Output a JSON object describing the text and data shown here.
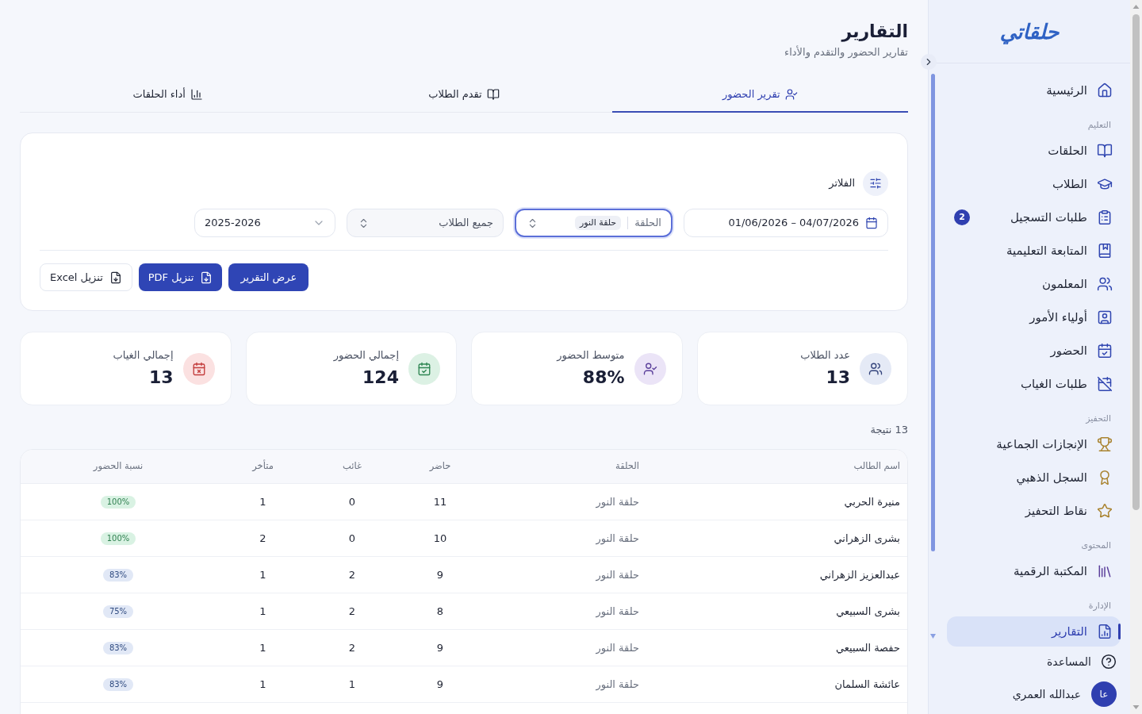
{
  "sidebar": {
    "logo": "حلقاتي",
    "sections": [
      {
        "items": [
          {
            "label": "الرئيسية",
            "selected": false
          }
        ]
      },
      {
        "title": "التعليم",
        "items": [
          {
            "label": "الحلقات",
            "selected": false
          },
          {
            "label": "الطلاب",
            "selected": false
          },
          {
            "label": "طلبات التسجيل",
            "selected": false,
            "badge": "2"
          },
          {
            "label": "المتابعة التعليمية",
            "selected": false
          },
          {
            "label": "المعلمون",
            "selected": false
          },
          {
            "label": "أولياء الأمور",
            "selected": false
          },
          {
            "label": "الحضور",
            "selected": false
          },
          {
            "label": "طلبات الغياب",
            "selected": false
          }
        ]
      },
      {
        "title": "التحفيز",
        "items": [
          {
            "label": "الإنجازات الجماعية",
            "selected": false
          },
          {
            "label": "السجل الذهبي",
            "selected": false
          },
          {
            "label": "نقاط التحفيز",
            "selected": false
          }
        ]
      },
      {
        "title": "المحتوى",
        "items": [
          {
            "label": "المكتبة الرقمية",
            "selected": false
          }
        ]
      },
      {
        "title": "الإدارة",
        "items": [
          {
            "label": "التقارير",
            "selected": true
          }
        ]
      }
    ],
    "help": "المساعدة",
    "user": {
      "initials": "عا",
      "name": "عبدالله العمري"
    }
  },
  "header": {
    "title": "التقارير",
    "subtitle": "تقارير الحضور والتقدم والأداء"
  },
  "tabs": [
    {
      "label": "تقرير الحضور",
      "selected": true
    },
    {
      "label": "تقدم الطلاب",
      "selected": false
    },
    {
      "label": "أداء الحلقات",
      "selected": false
    }
  ],
  "filters": {
    "title": "الفلاتر",
    "fields": [
      {
        "kind": "daterange",
        "value": "01/06/2026 – 04/07/2026",
        "focused": false,
        "disabled": false
      },
      {
        "kind": "chips",
        "label": "الحلقة",
        "chips": [
          "حلقة النور"
        ],
        "focused": true,
        "disabled": false
      },
      {
        "kind": "combo",
        "value": "جميع الطلاب",
        "focused": false,
        "disabled": true
      },
      {
        "kind": "select",
        "value": "2025-2026",
        "focused": false,
        "disabled": false
      }
    ],
    "buttons": [
      {
        "kind": "primary",
        "label": "عرض التقرير"
      },
      {
        "kind": "download",
        "label": "تنزيل PDF"
      },
      {
        "kind": "outline",
        "label": "تنزيل Excel"
      }
    ]
  },
  "stats": [
    {
      "kind": "students",
      "label": "عدد الطلاب",
      "value": "13"
    },
    {
      "kind": "average",
      "label": "متوسط الحضور",
      "value": "88%"
    },
    {
      "kind": "present",
      "label": "إجمالي الحضور",
      "value": "124"
    },
    {
      "kind": "absent",
      "label": "إجمالي الغياب",
      "value": "13"
    }
  ],
  "results_count": "13 نتيجة",
  "table": {
    "columns": [
      "اسم الطالب",
      "الحلقة",
      "حاضر",
      "غائب",
      "متأخر",
      "نسبة الحضور"
    ],
    "rows": [
      {
        "name": "منيرة الحربي",
        "circle": "حلقة النور",
        "present": "11",
        "absent": "0",
        "late": "1",
        "rate": "100%",
        "color": "#d9f2e3"
      },
      {
        "name": "بشرى الزهراني",
        "circle": "حلقة النور",
        "present": "10",
        "absent": "0",
        "late": "2",
        "rate": "100%",
        "color": "#d9f2e3"
      },
      {
        "name": "عبدالعزيز الزهراني",
        "circle": "حلقة النور",
        "present": "9",
        "absent": "2",
        "late": "1",
        "rate": "83%",
        "color": "#e1e8f6"
      },
      {
        "name": "بشرى السبيعي",
        "circle": "حلقة النور",
        "present": "8",
        "absent": "2",
        "late": "1",
        "rate": "75%",
        "color": "#e1e8f6"
      },
      {
        "name": "حفصة السبيعي",
        "circle": "حلقة النور",
        "present": "9",
        "absent": "2",
        "late": "1",
        "rate": "83%",
        "color": "#e1e8f6"
      },
      {
        "name": "عائشة السلمان",
        "circle": "حلقة النور",
        "present": "9",
        "absent": "1",
        "late": "1",
        "rate": "83%",
        "color": "#e1e8f6"
      }
    ]
  }
}
